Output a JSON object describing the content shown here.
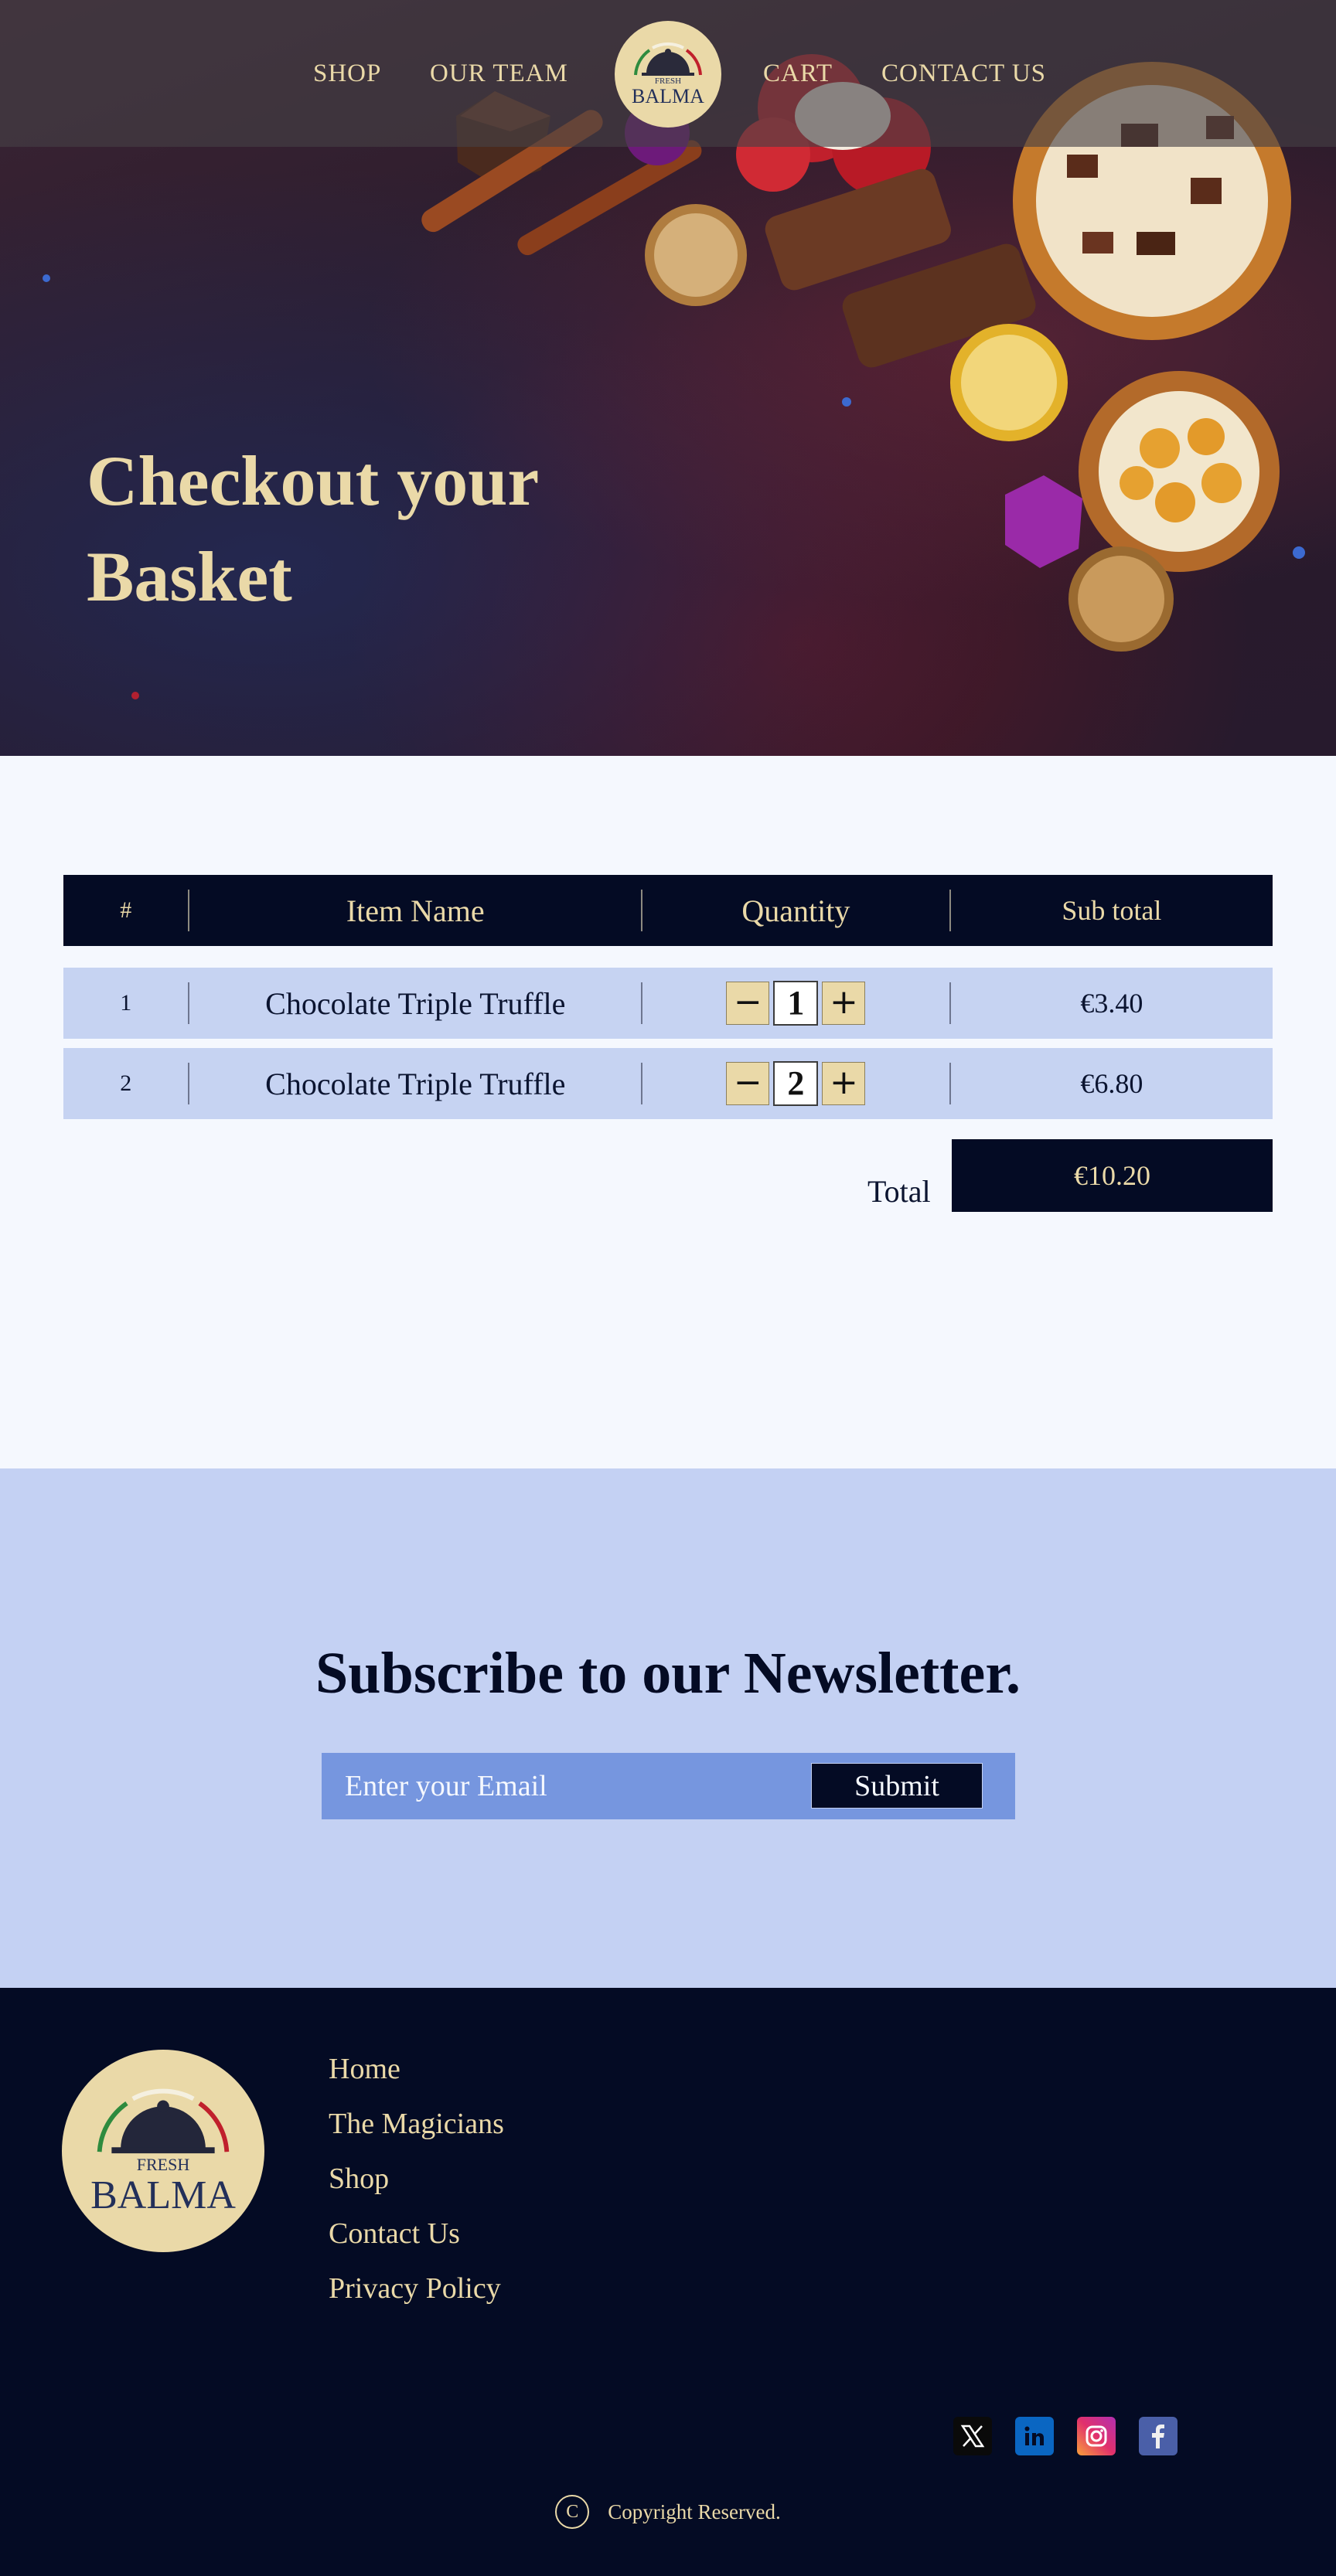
{
  "nav": {
    "shop": "SHOP",
    "team": "OUR TEAM",
    "cart": "CART",
    "contact": "CONTACT US"
  },
  "brand": {
    "top": "FRESH",
    "name": "BALMA"
  },
  "hero": {
    "title_line1": "Checkout your",
    "title_line2": "Basket"
  },
  "cart": {
    "headers": {
      "num": "#",
      "name": "Item Name",
      "qty": "Quantity",
      "sub": "Sub total"
    },
    "items": [
      {
        "num": "1",
        "name": "Chocolate Triple Truffle",
        "qty": "1",
        "sub": "€3.40"
      },
      {
        "num": "2",
        "name": "Chocolate Triple Truffle",
        "qty": "2",
        "sub": "€6.80"
      }
    ],
    "minus": "−",
    "plus": "+",
    "total_label": "Total",
    "total_value": "€10.20"
  },
  "newsletter": {
    "title": "Subscribe to our Newsletter.",
    "placeholder": "Enter your Email",
    "submit": "Submit"
  },
  "footer": {
    "links": [
      "Home",
      "The Magicians",
      "Shop",
      "Contact Us",
      "Privacy Policy"
    ],
    "social_icons": [
      "x-icon",
      "linkedin-icon",
      "instagram-icon",
      "facebook-icon"
    ],
    "copyright_symbol": "C",
    "copyright": "Copyright Reserved."
  },
  "colors": {
    "navy": "#040b24",
    "cream": "#ead9a8",
    "light_blue": "#c4d1f3",
    "row_blue": "#c6d3f2",
    "form_blue": "#7696df"
  }
}
